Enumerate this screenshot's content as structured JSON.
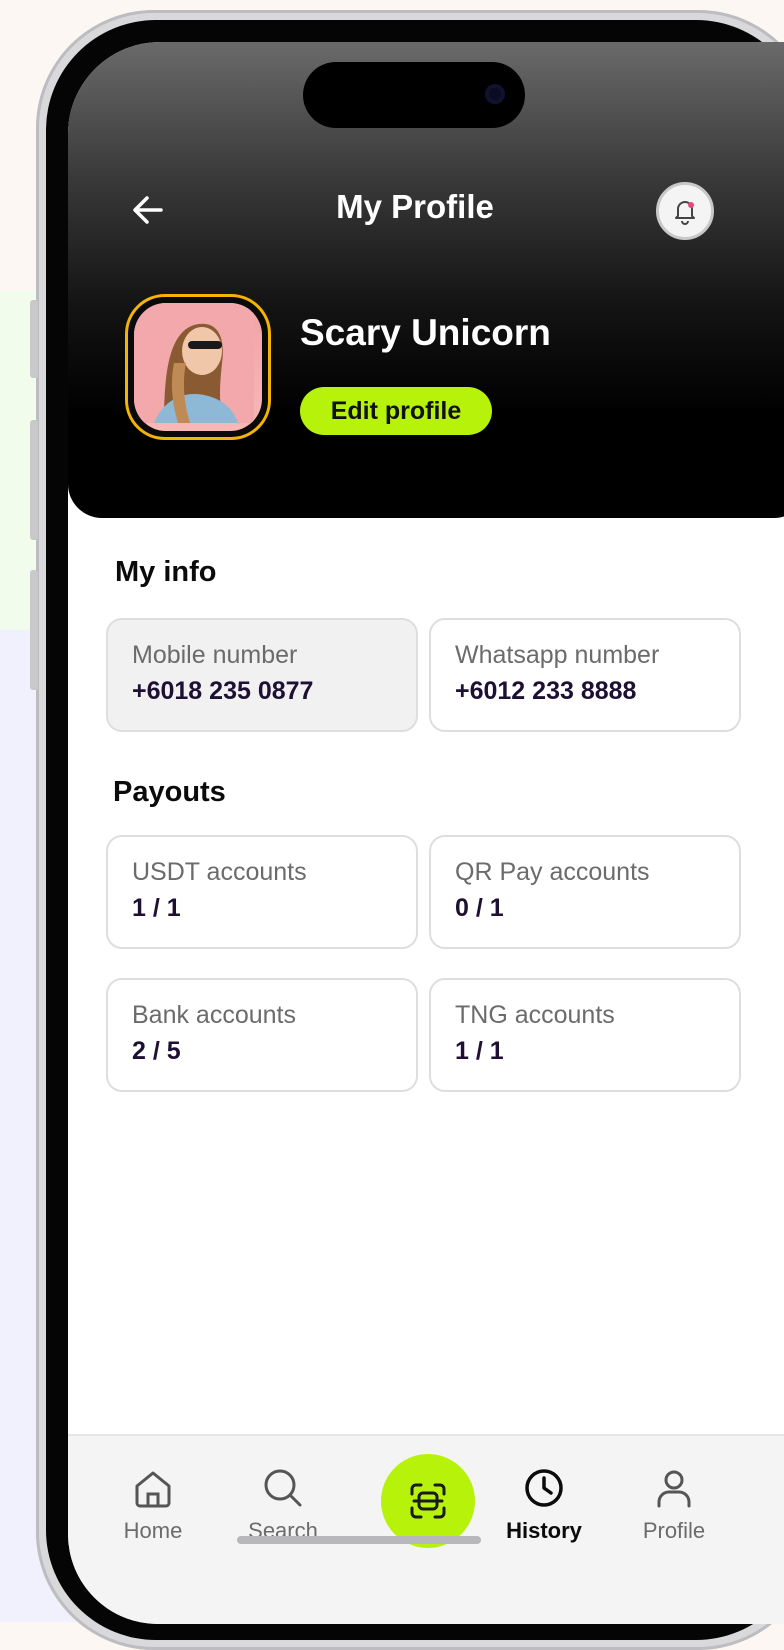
{
  "header": {
    "title": "My Profile",
    "back_icon": "arrow-left-icon",
    "notification_icon": "bell-icon"
  },
  "profile": {
    "name": "Scary Unicorn",
    "edit_label": "Edit profile",
    "avatar_border_color": "#f4b400"
  },
  "my_info": {
    "title": "My info",
    "cards": [
      {
        "label": "Mobile number",
        "value": "+6018 235 0877"
      },
      {
        "label": "Whatsapp number",
        "value": "+6012 233 8888"
      }
    ]
  },
  "payouts": {
    "title": "Payouts",
    "cards": [
      {
        "label": "USDT accounts",
        "value": "1 / 1"
      },
      {
        "label": "QR Pay accounts",
        "value": "0 / 1"
      },
      {
        "label": "Bank accounts",
        "value": "2 / 5"
      },
      {
        "label": "TNG accounts",
        "value": "1 / 1"
      }
    ]
  },
  "nav": {
    "items": [
      {
        "label": "Home",
        "icon": "home-icon"
      },
      {
        "label": "Search",
        "icon": "search-icon"
      },
      {
        "label": "",
        "icon": "scan-icon"
      },
      {
        "label": "History",
        "icon": "clock-icon",
        "active": true
      },
      {
        "label": "Profile",
        "icon": "user-icon"
      }
    ]
  },
  "colors": {
    "accent": "#b7f20b",
    "header_bg": "#000000",
    "text_dark": "#1d1033"
  }
}
